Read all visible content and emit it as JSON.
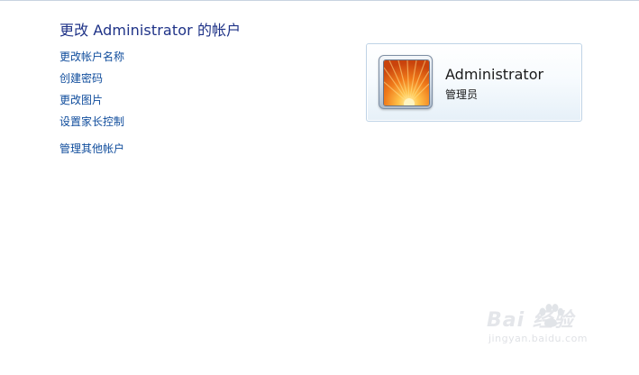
{
  "page": {
    "title": "更改 Administrator 的帐户"
  },
  "tasks": [
    {
      "label": "更改帐户名称"
    },
    {
      "label": "创建密码"
    },
    {
      "label": "更改图片"
    },
    {
      "label": "设置家长控制"
    },
    {
      "label": "管理其他帐户"
    }
  ],
  "account": {
    "name": "Administrator",
    "role": "管理员",
    "avatar_icon": "orange-flower-icon"
  },
  "watermark": {
    "brand": "Bai  经验",
    "url": "jingyan.baidu.com"
  },
  "colors": {
    "link": "#0f4c9c",
    "title": "#1e3287",
    "card_border": "#bfd3e6"
  }
}
